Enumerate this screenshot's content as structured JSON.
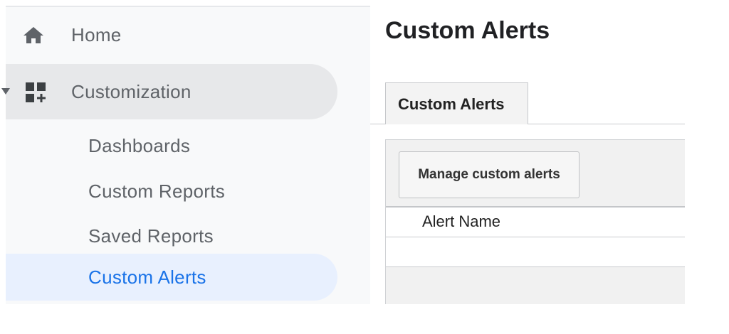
{
  "sidebar": {
    "home": {
      "label": "Home",
      "icon": "home-icon"
    },
    "customization": {
      "label": "Customization",
      "icon": "customization-icon",
      "expanded": true
    },
    "sub_items": {
      "dashboards": "Dashboards",
      "custom_reports": "Custom Reports",
      "saved_reports": "Saved Reports",
      "custom_alerts": "Custom Alerts"
    },
    "active_item": "Custom Alerts"
  },
  "main": {
    "title": "Custom Alerts",
    "tabs": [
      {
        "label": "Custom Alerts",
        "selected": true
      }
    ],
    "manage_button_label": "Manage custom alerts",
    "table": {
      "columns": [
        "Alert Name"
      ],
      "rows": []
    }
  },
  "colors": {
    "active_text": "#1a73e8",
    "active_bg": "#e8f0fe",
    "nav_text": "#5f6368",
    "expanded_bg": "#e7e8ea"
  }
}
